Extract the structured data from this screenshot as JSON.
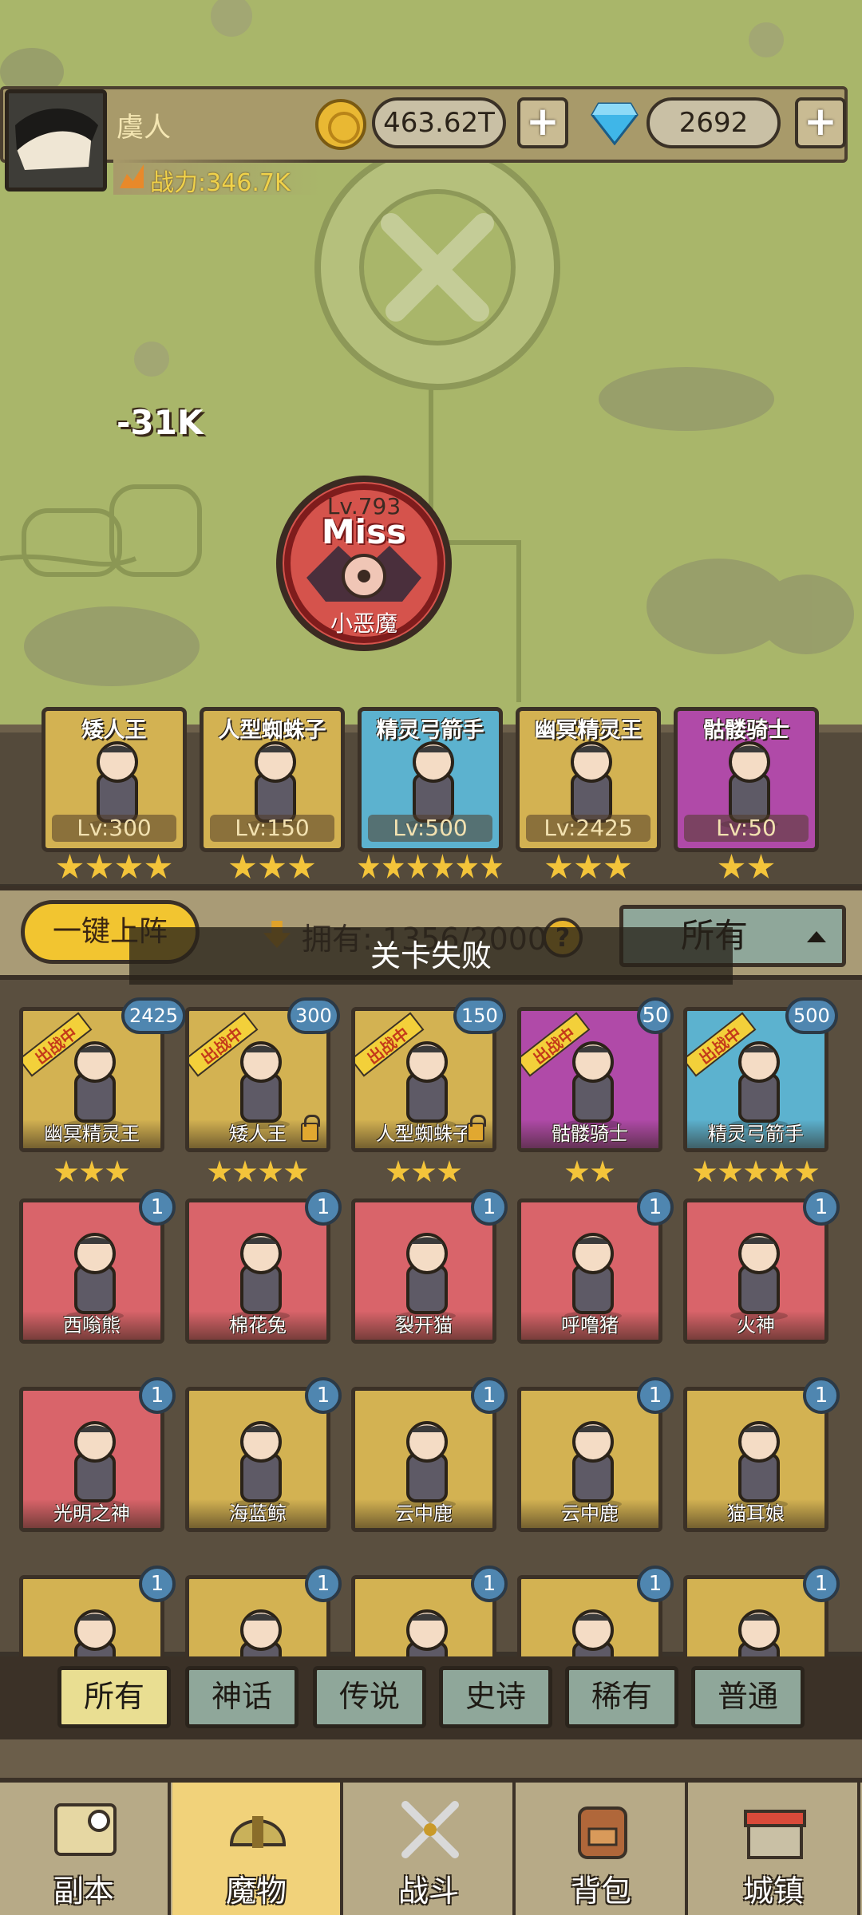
{
  "player": {
    "name": "虞人",
    "power": "战力:346.7K"
  },
  "currency": {
    "gold": "463.62T",
    "gems": "2692",
    "plus": "+"
  },
  "battle": {
    "damage": "-31K",
    "boss_level": "Lv.793",
    "miss_text": "Miss",
    "boss_name": "小恶魔"
  },
  "squad": [
    {
      "name": "矮人王",
      "level": "Lv:300",
      "stars": 4,
      "color": "#d3b252"
    },
    {
      "name": "人型蜘蛛子",
      "level": "Lv:150",
      "stars": 3,
      "color": "#d3b252"
    },
    {
      "name": "精灵弓箭手",
      "level": "Lv:500",
      "stars": 6,
      "color": "#5cb2cf"
    },
    {
      "name": "幽冥精灵王",
      "level": "Lv:2425",
      "stars": 3,
      "color": "#d3b252"
    },
    {
      "name": "骷髅骑士",
      "level": "Lv:50",
      "stars": 2,
      "color": "#b04aa8"
    }
  ],
  "panel": {
    "one_key_label": "一键上阵",
    "owned_text": "拥有: 1356/2000",
    "help": "?",
    "filter_select": "所有",
    "toast": "关卡失败"
  },
  "deployed": [
    {
      "name": "幽冥精灵王",
      "count": "2425",
      "stars": 3,
      "color": "#d3b252",
      "ribbon": "出战中",
      "locked": false
    },
    {
      "name": "矮人王",
      "count": "300",
      "stars": 4,
      "color": "#d3b252",
      "ribbon": "出战中",
      "locked": true
    },
    {
      "name": "人型蜘蛛子",
      "count": "150",
      "stars": 3,
      "color": "#d3b252",
      "ribbon": "出战中",
      "locked": true
    },
    {
      "name": "骷髅骑士",
      "count": "50",
      "stars": 2,
      "color": "#b04aa8",
      "ribbon": "出战中",
      "locked": false
    },
    {
      "name": "精灵弓箭手",
      "count": "500",
      "stars": 5,
      "color": "#5cb2cf",
      "ribbon": "出战中",
      "locked": false
    }
  ],
  "monsters_row2": [
    {
      "name": "西嗡熊",
      "count": "1",
      "color": "#d9646a"
    },
    {
      "name": "棉花兔",
      "count": "1",
      "color": "#d9646a"
    },
    {
      "name": "裂开猫",
      "count": "1",
      "color": "#d9646a"
    },
    {
      "name": "呼噜猪",
      "count": "1",
      "color": "#d9646a"
    },
    {
      "name": "火神",
      "count": "1",
      "color": "#d9646a"
    }
  ],
  "monsters_row3": [
    {
      "name": "光明之神",
      "count": "1",
      "color": "#d9646a"
    },
    {
      "name": "海蓝鲸",
      "count": "1",
      "color": "#d3b252"
    },
    {
      "name": "云中鹿",
      "count": "1",
      "color": "#d3b252"
    },
    {
      "name": "云中鹿",
      "count": "1",
      "color": "#d3b252"
    },
    {
      "name": "猫耳娘",
      "count": "1",
      "color": "#d3b252"
    }
  ],
  "monsters_row4": [
    {
      "count": "1",
      "color": "#d3b252"
    },
    {
      "count": "1",
      "color": "#d3b252"
    },
    {
      "count": "1",
      "color": "#d3b252"
    },
    {
      "count": "1",
      "color": "#d3b252"
    },
    {
      "count": "1",
      "color": "#d3b252"
    }
  ],
  "filters": [
    "所有",
    "神话",
    "传说",
    "史诗",
    "稀有",
    "普通"
  ],
  "nav": [
    {
      "label": "副本",
      "icon": "map-icon"
    },
    {
      "label": "魔物",
      "icon": "helmet-icon"
    },
    {
      "label": "战斗",
      "icon": "swords-icon"
    },
    {
      "label": "背包",
      "icon": "backpack-icon"
    },
    {
      "label": "城镇",
      "icon": "shop-icon"
    }
  ]
}
